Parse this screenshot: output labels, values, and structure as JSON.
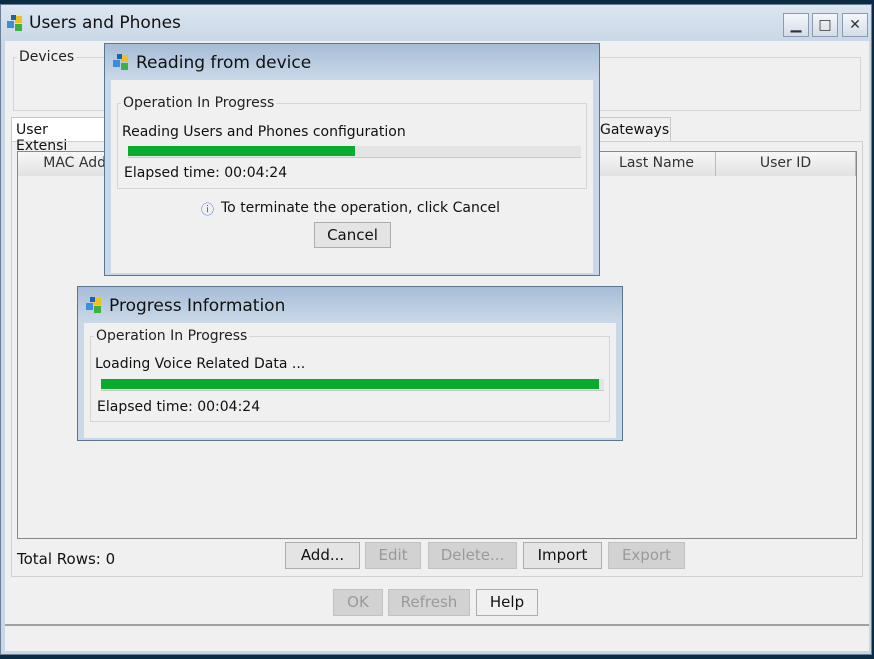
{
  "window": {
    "title": "Users and Phones",
    "icon": "app-cubes-icon",
    "controls": [
      "minimize-icon",
      "maximize-icon",
      "close-icon"
    ]
  },
  "devices_group": {
    "label": "Devices"
  },
  "tabs": [
    {
      "label": "User Extensi"
    },
    {
      "label": "Gateways"
    }
  ],
  "table": {
    "columns": [
      "MAC Addr",
      "Last Name",
      "User ID"
    ],
    "rows": []
  },
  "footer": {
    "total_rows": "Total Rows: 0",
    "buttons": [
      {
        "label": "Add...",
        "enabled": true
      },
      {
        "label": "Edit",
        "enabled": false
      },
      {
        "label": "Delete...",
        "enabled": false
      },
      {
        "label": "Import",
        "enabled": true
      },
      {
        "label": "Export",
        "enabled": false
      }
    ]
  },
  "bottom_buttons": [
    {
      "label": "OK",
      "enabled": false
    },
    {
      "label": "Refresh",
      "enabled": false
    },
    {
      "label": "Help",
      "enabled": true
    }
  ],
  "reading_dialog": {
    "title": "Reading from device",
    "group": "Operation In Progress",
    "message": "Reading Users and Phones configuration",
    "progress_percent": 50,
    "elapsed": "Elapsed time: 00:04:24",
    "hint": "To terminate the operation, click Cancel",
    "cancel_label": "Cancel"
  },
  "progress_dialog": {
    "title": "Progress Information",
    "group": "Operation In Progress",
    "message": "Loading Voice Related Data ...",
    "progress_percent": 99,
    "elapsed": "Elapsed time: 00:04:24"
  },
  "colors": {
    "progress": "#08ab2b",
    "title_bar": "#c8d6e6"
  }
}
